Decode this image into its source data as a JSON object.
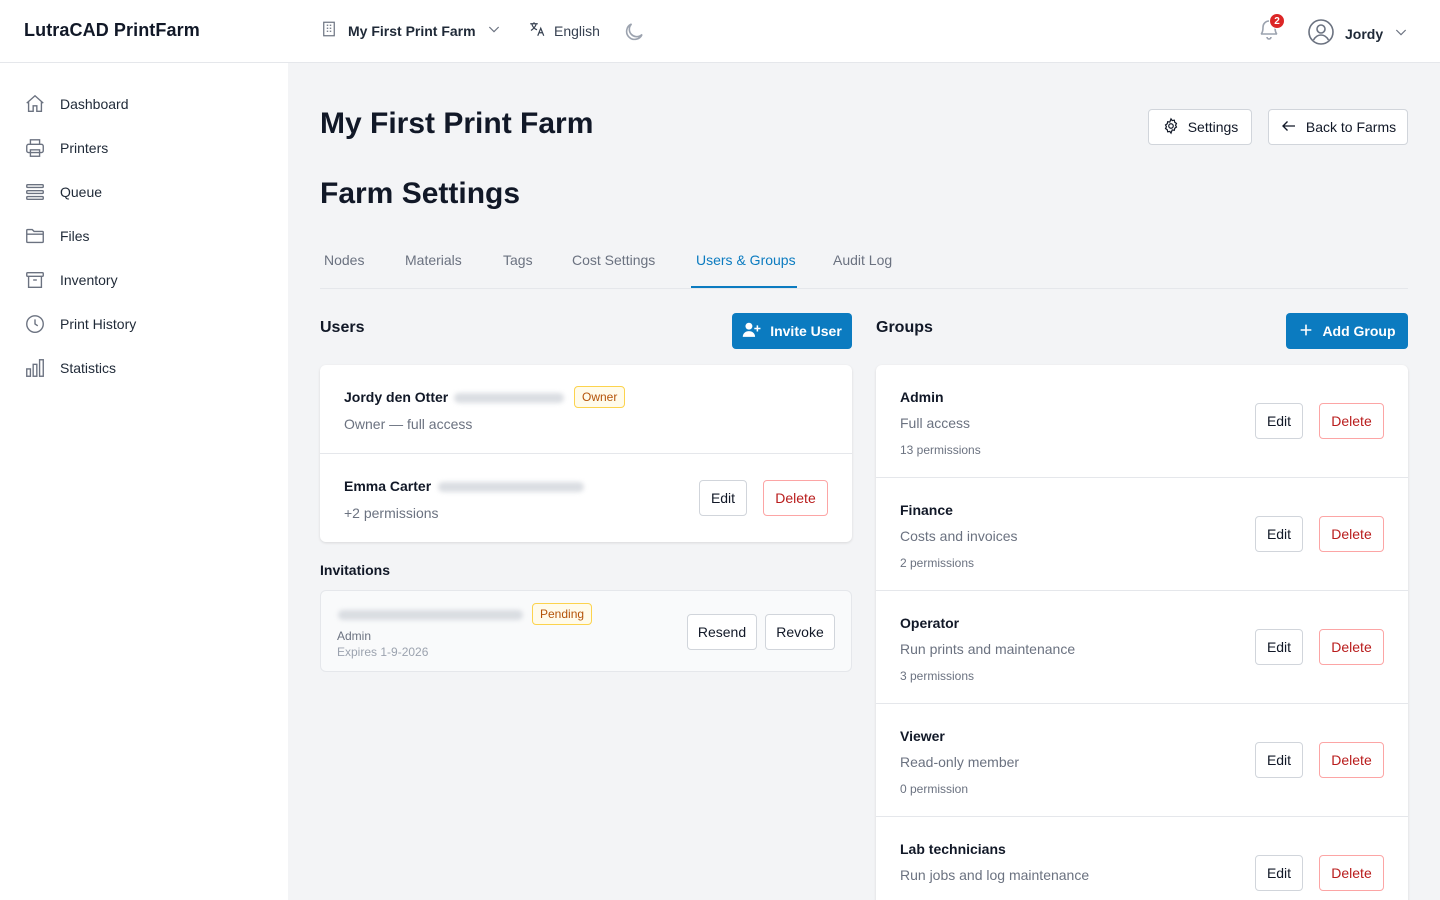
{
  "app": {
    "title": "LutraCAD PrintFarm"
  },
  "topbar": {
    "farm_name": "My First Print Farm",
    "language": "English",
    "notifications_count": "2",
    "user_name": "Jordy"
  },
  "sidebar": {
    "items": [
      {
        "label": "Dashboard",
        "icon": "home-icon"
      },
      {
        "label": "Printers",
        "icon": "printer-icon"
      },
      {
        "label": "Queue",
        "icon": "queue-icon"
      },
      {
        "label": "Files",
        "icon": "folder-icon"
      },
      {
        "label": "Inventory",
        "icon": "archive-icon"
      },
      {
        "label": "Print History",
        "icon": "clock-icon"
      },
      {
        "label": "Statistics",
        "icon": "bar-chart-icon"
      }
    ]
  },
  "page": {
    "farm_title": "My First Print Farm",
    "settings_title": "Farm Settings",
    "settings_button": "Settings",
    "back_button": "Back to Farms"
  },
  "tabs": [
    {
      "label": "Nodes"
    },
    {
      "label": "Materials"
    },
    {
      "label": "Tags"
    },
    {
      "label": "Cost Settings"
    },
    {
      "label": "Users & Groups",
      "active": true
    },
    {
      "label": "Audit Log"
    }
  ],
  "users": {
    "title": "Users",
    "invite_button": "Invite User",
    "list": [
      {
        "name": "Jordy den Otter",
        "badge": "Owner",
        "description": "Owner — full access"
      },
      {
        "name": "Emma Carter",
        "description": "+2 permissions",
        "edit": "Edit",
        "delete": "Delete"
      }
    ]
  },
  "invitations": {
    "title": "Invitations",
    "list": [
      {
        "badge": "Pending",
        "role": "Admin",
        "expires": "Expires 1-9-2026",
        "resend": "Resend",
        "revoke": "Revoke"
      }
    ]
  },
  "groups": {
    "title": "Groups",
    "add_button": "Add Group",
    "list": [
      {
        "name": "Admin",
        "description": "Full access",
        "permissions": "13 permissions",
        "edit": "Edit",
        "delete": "Delete"
      },
      {
        "name": "Finance",
        "description": "Costs and invoices",
        "permissions": "2 permissions",
        "edit": "Edit",
        "delete": "Delete"
      },
      {
        "name": "Operator",
        "description": "Run prints and maintenance",
        "permissions": "3 permissions",
        "edit": "Edit",
        "delete": "Delete"
      },
      {
        "name": "Viewer",
        "description": "Read-only member",
        "permissions": "0 permission",
        "edit": "Edit",
        "delete": "Delete"
      },
      {
        "name": "Lab technicians",
        "description": "Run jobs and log maintenance",
        "permissions": "",
        "edit": "Edit",
        "delete": "Delete"
      }
    ]
  },
  "colors": {
    "accent": "#0b7bc0",
    "danger": "#b91c1c",
    "badge_warning": "#b45309",
    "background": "#f3f4f6"
  }
}
